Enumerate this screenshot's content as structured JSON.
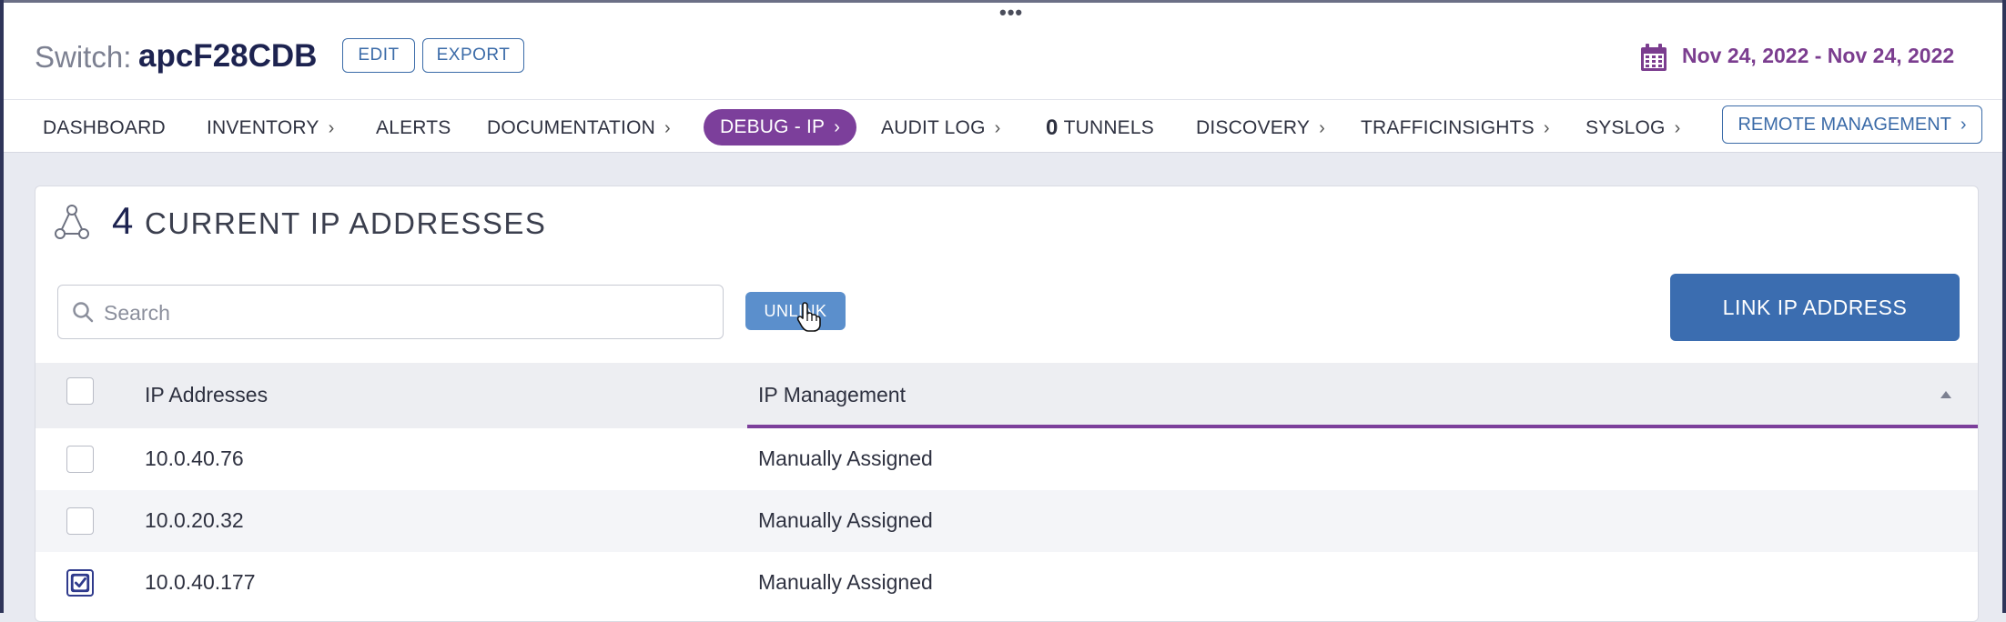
{
  "window": {
    "grip": "•••"
  },
  "header": {
    "title_prefix": "Switch:",
    "title_name": "apcF28CDB",
    "edit_label": "EDIT",
    "export_label": "EXPORT",
    "date_range": "Nov 24, 2022 - Nov 24, 2022",
    "accent_color": "#7b3d8f"
  },
  "nav": {
    "items": [
      {
        "label": "DASHBOARD",
        "chevron": false
      },
      {
        "label": "INVENTORY",
        "chevron": true
      },
      {
        "label": "ALERTS",
        "chevron": false
      },
      {
        "label": "DOCUMENTATION",
        "chevron": true
      },
      {
        "label": "DEBUG - IP",
        "chevron": true,
        "active": true
      },
      {
        "label": "AUDIT LOG",
        "chevron": true
      },
      {
        "count": "0",
        "label": "TUNNELS",
        "chevron": false
      },
      {
        "label": "DISCOVERY",
        "chevron": true
      },
      {
        "label": "TRAFFICINSIGHTS",
        "chevron": true
      },
      {
        "label": "SYSLOG",
        "chevron": true
      }
    ],
    "remote_management_label": "REMOTE MANAGEMENT",
    "active_color": "#7c3f9b"
  },
  "panel": {
    "count": "4",
    "title": "CURRENT IP ADDRESSES",
    "search_placeholder": "Search",
    "search_value": "",
    "unlink_label": "UNLINK",
    "link_label": "LINK IP ADDRESS",
    "table": {
      "columns": [
        "IP Addresses",
        "IP Management"
      ],
      "rows": [
        {
          "ip": "10.0.40.76",
          "management": "Manually Assigned",
          "checked": false
        },
        {
          "ip": "10.0.20.32",
          "management": "Manually Assigned",
          "checked": false
        },
        {
          "ip": "10.0.40.177",
          "management": "Manually Assigned",
          "checked": true
        }
      ]
    }
  }
}
